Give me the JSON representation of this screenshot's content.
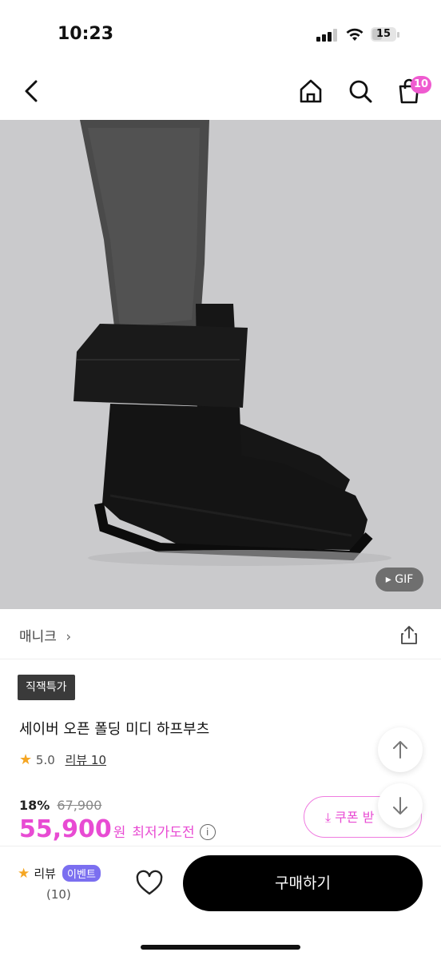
{
  "status": {
    "time": "10:23",
    "battery": "15"
  },
  "nav": {
    "cart_count": "10"
  },
  "hero": {
    "gif_label": "GIF"
  },
  "brand": {
    "name": "매니크"
  },
  "product": {
    "tag": "직잭특가",
    "title": "세이버 오픈 폴딩 미디 하프부츠",
    "rating": "5.0",
    "review_link": "리뷰 10",
    "discount_pct": "18%",
    "original_price": "67,900",
    "price": "55,900",
    "currency": "원",
    "price_challenge": "최저가도전"
  },
  "coupon": {
    "label": "쿠폰 받"
  },
  "bottom": {
    "review_label": "리뷰",
    "event_badge": "이벤트",
    "review_count": "(10)",
    "buy_label": "구매하기"
  },
  "colors": {
    "accent": "#e84bd3",
    "badge": "#ef5bd0",
    "event": "#7b6ff0"
  }
}
